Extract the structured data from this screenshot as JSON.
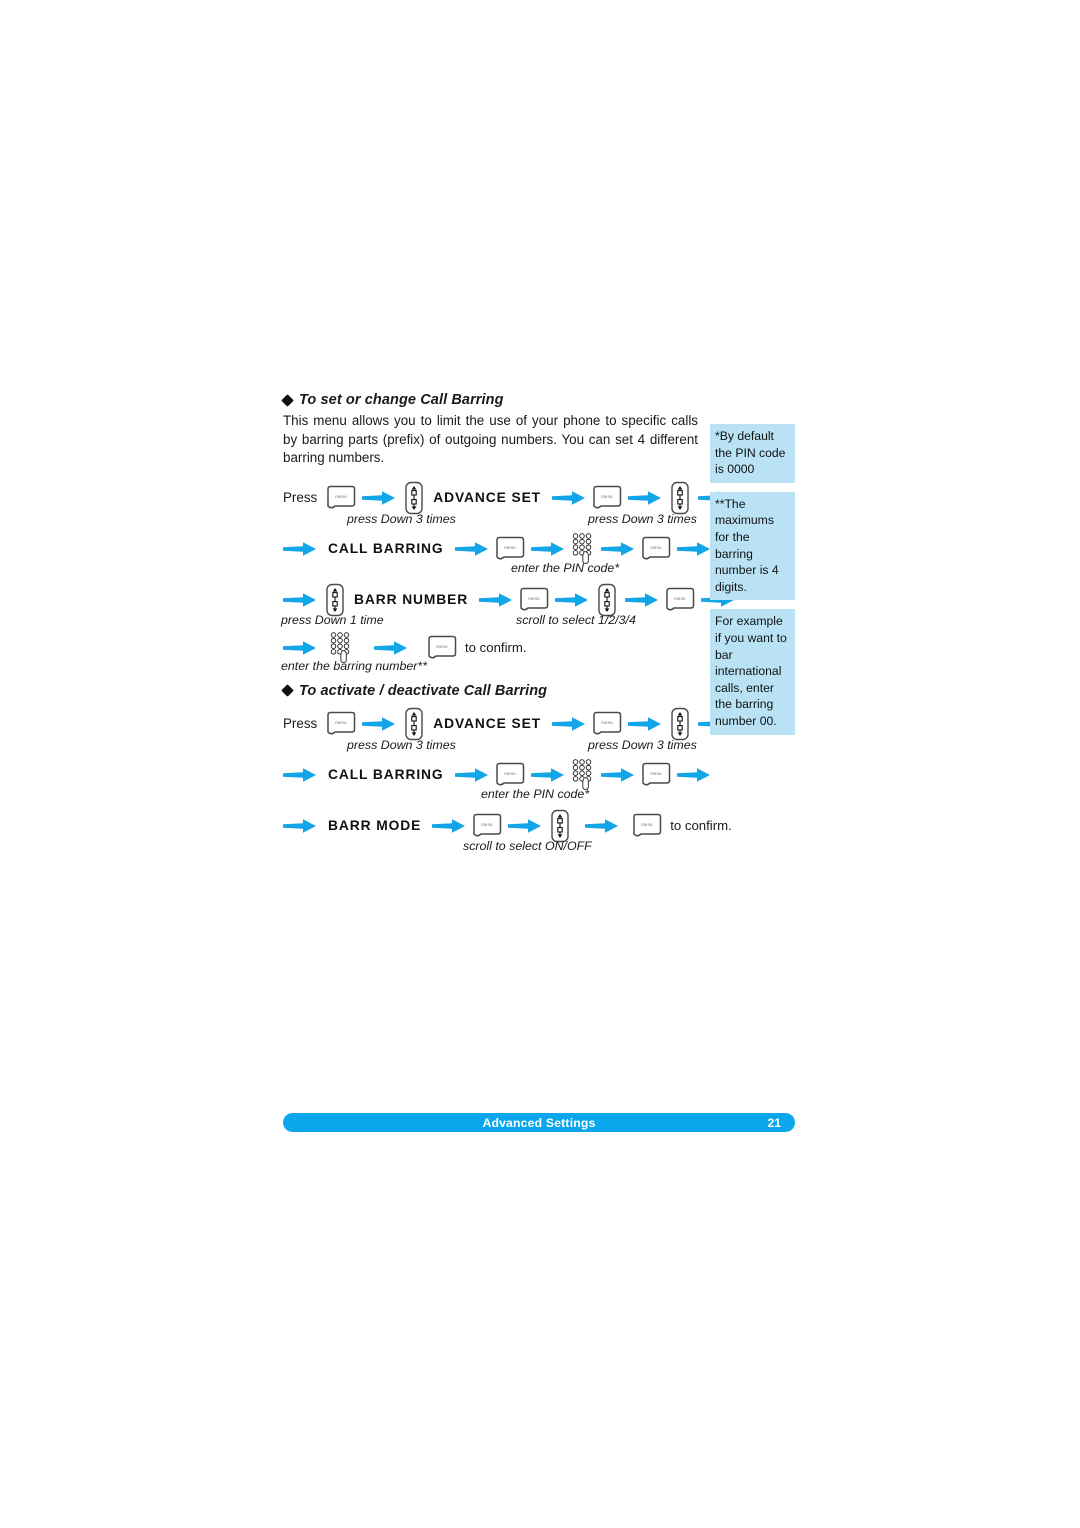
{
  "document": {
    "page_number": "21",
    "footer_title": "Advanced Settings",
    "accent_color": "#0aa7ec",
    "note_bg_color": "#b9e3f5"
  },
  "sections": [
    {
      "heading": "To set or change Call Barring",
      "intro": "This menu allows you to limit the use of your phone to specific calls by barring parts (prefix) of outgoing numbers. You can set 4 different barring numbers.",
      "press_label": "Press",
      "steps": {
        "advance_set": "ADVANCE SET",
        "call_barring": "CALL BARRING",
        "barr_number": "BARR NUMBER",
        "to_confirm": "to confirm."
      },
      "captions": {
        "press_down_3_times_a": "press Down 3 times",
        "press_down_3_times_b": "press Down 3 times",
        "enter_pin_code": "enter the PIN code*",
        "press_down_1_time": "press Down 1 time",
        "scroll_to_select_number": "scroll to select 1/2/3/4",
        "enter_barring_number": "enter the barring number**"
      }
    },
    {
      "heading": "To activate / deactivate Call Barring",
      "press_label": "Press",
      "steps": {
        "advance_set": "ADVANCE SET",
        "call_barring": "CALL BARRING",
        "barr_mode": "BARR MODE",
        "to_confirm": "to confirm."
      },
      "captions": {
        "press_down_3_times_a": "press Down 3 times",
        "press_down_3_times_b": "press Down 3 times",
        "enter_pin_code": "enter the PIN code*",
        "scroll_to_select_mode": "scroll to select ON/OFF"
      }
    }
  ],
  "notes": [
    {
      "text": "*By default the PIN code is 0000"
    },
    {
      "text": "**The maximums for the barring number is 4 digits."
    },
    {
      "text": "For example if you want to bar international calls, enter the barring number 00."
    }
  ],
  "icons": {
    "menu_key_label": "menu",
    "menu_key_name": "menu-key-icon",
    "nav_key_name": "nav-updown-key-icon",
    "keypad_name": "keypad-icon",
    "arrow_name": "arrow-right-icon",
    "bullet_name": "diamond-bullet-icon"
  }
}
